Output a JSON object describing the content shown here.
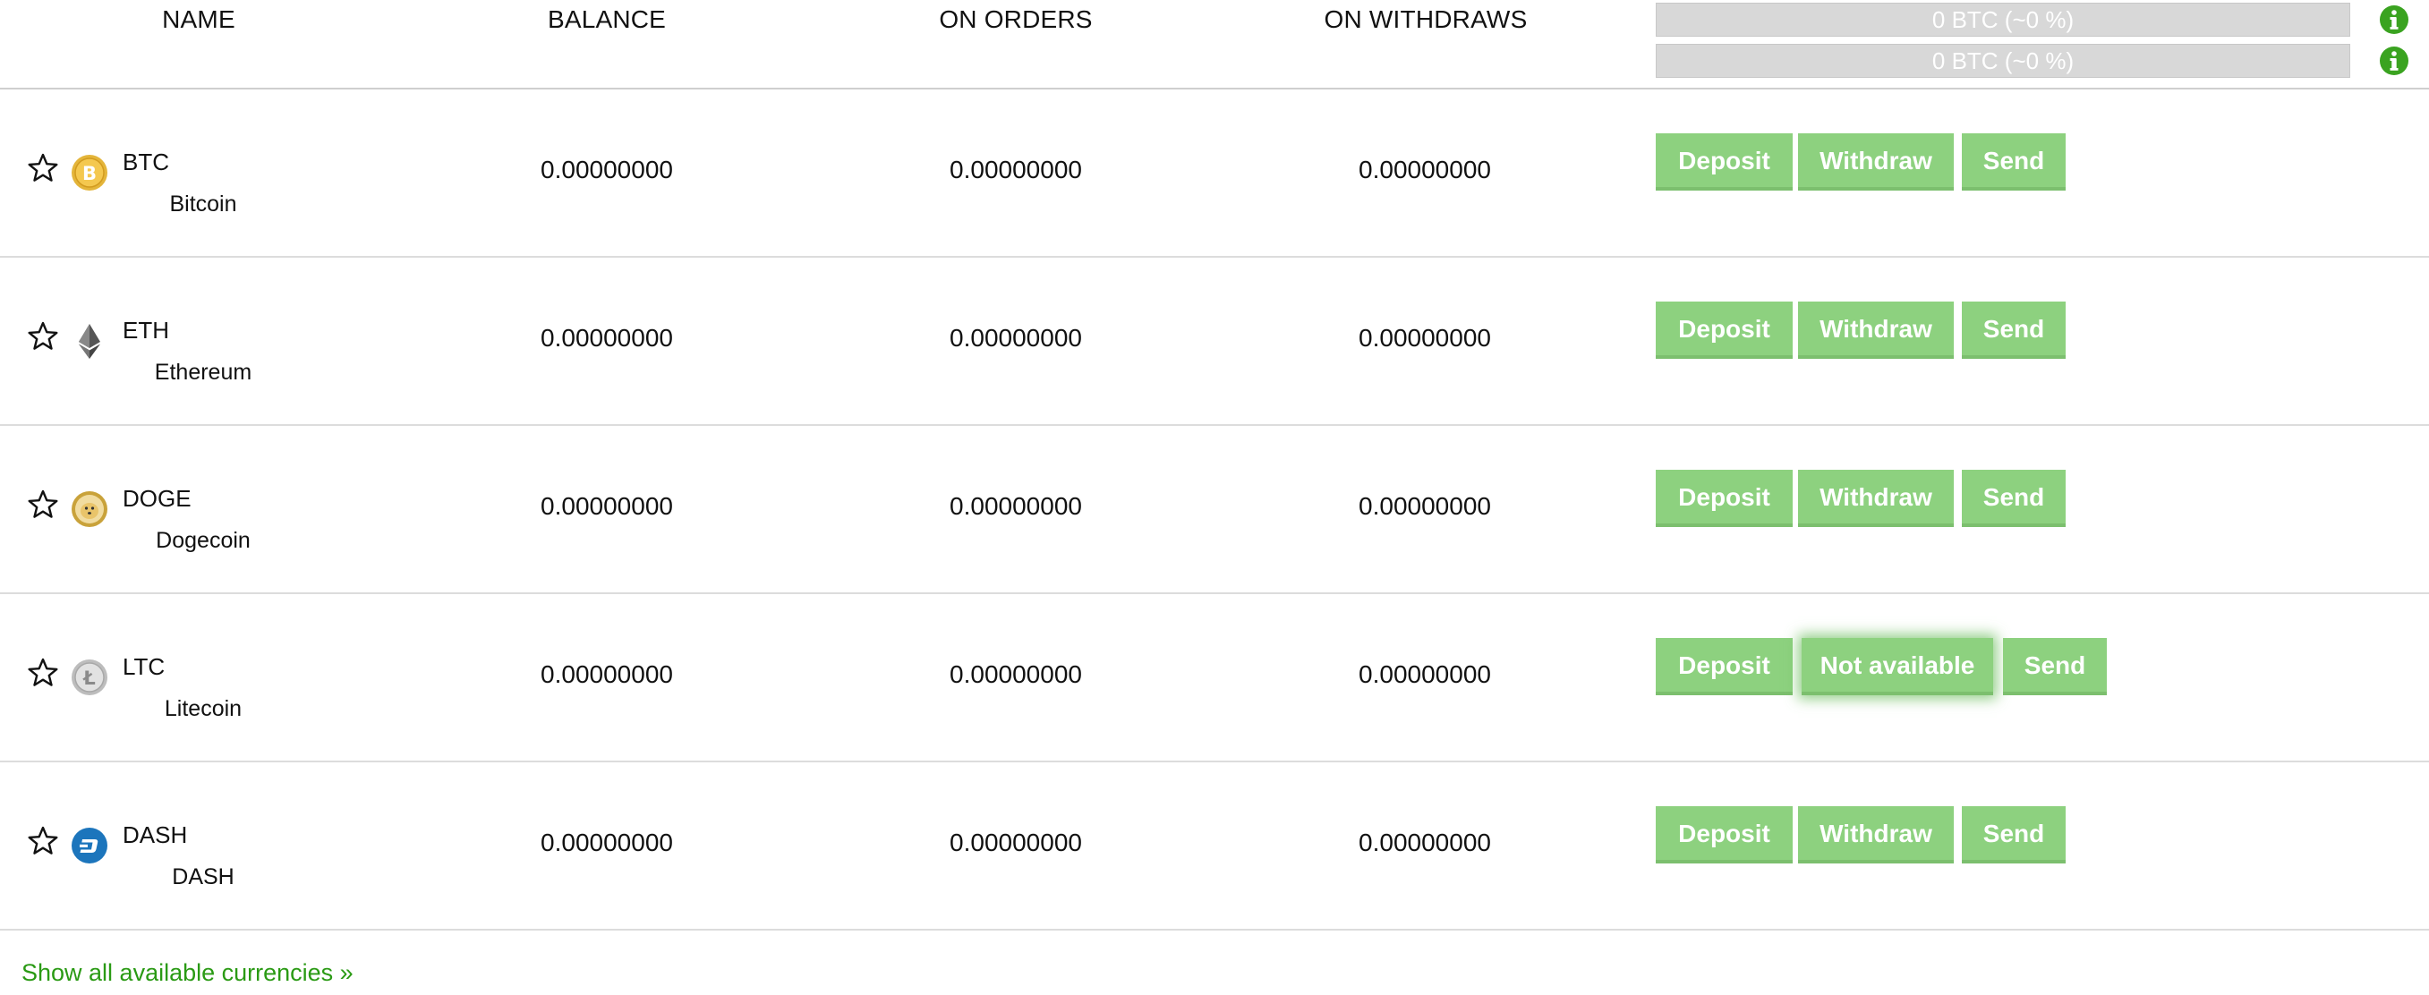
{
  "header": {
    "name": "NAME",
    "balance": "BALANCE",
    "on_orders": "ON ORDERS",
    "on_withdraws": "ON WITHDRAWS",
    "summary_1": "0 BTC (~0 %)",
    "summary_2": "0 BTC (~0 %)"
  },
  "rows": [
    {
      "ticker": "BTC",
      "name": "Bitcoin",
      "balance": "0.00000000",
      "on_orders": "0.00000000",
      "on_withdraws": "0.00000000",
      "icon": "bitcoin-icon"
    },
    {
      "ticker": "ETH",
      "name": "Ethereum",
      "balance": "0.00000000",
      "on_orders": "0.00000000",
      "on_withdraws": "0.00000000",
      "icon": "ethereum-icon"
    },
    {
      "ticker": "DOGE",
      "name": "Dogecoin",
      "balance": "0.00000000",
      "on_orders": "0.00000000",
      "on_withdraws": "0.00000000",
      "icon": "dogecoin-icon"
    },
    {
      "ticker": "LTC",
      "name": "Litecoin",
      "balance": "0.00000000",
      "on_orders": "0.00000000",
      "on_withdraws": "0.00000000",
      "icon": "litecoin-icon"
    },
    {
      "ticker": "DASH",
      "name": "DASH",
      "balance": "0.00000000",
      "on_orders": "0.00000000",
      "on_withdraws": "0.00000000",
      "icon": "dash-icon"
    }
  ],
  "buttons": {
    "deposit": "Deposit",
    "withdraw": "Withdraw",
    "send": "Send",
    "not_available": "Not available"
  },
  "footer": {
    "show_all": "Show all available currencies »"
  },
  "colors": {
    "button_green": "#8dd17f",
    "link_green": "#2a9a14",
    "info_green": "#3aa320",
    "summary_bar_gray": "#d8d8d8"
  }
}
